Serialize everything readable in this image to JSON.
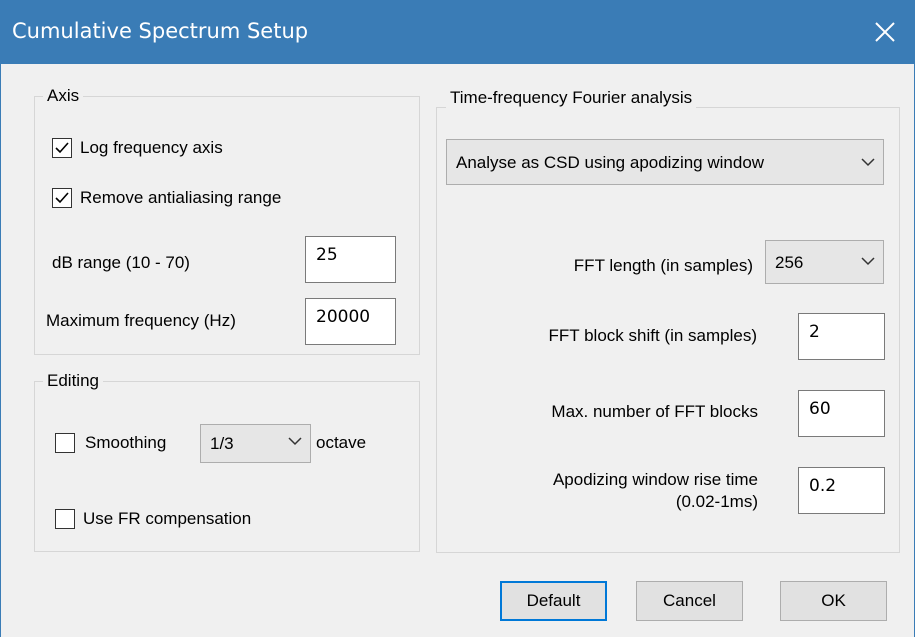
{
  "window": {
    "title": "Cumulative Spectrum Setup",
    "close_icon": "close-icon"
  },
  "axis": {
    "legend": "Axis",
    "log_frequency_label": "Log frequency axis",
    "log_frequency_checked": true,
    "remove_antialiasing_label": "Remove antialiasing range",
    "remove_antialiasing_checked": true,
    "db_range_label": "dB range (10 - 70)",
    "db_range_value": "25",
    "max_frequency_label": "Maximum frequency (Hz)",
    "max_frequency_value": "20000"
  },
  "editing": {
    "legend": "Editing",
    "smoothing_label": "Smoothing",
    "smoothing_checked": false,
    "smoothing_value": "1/3",
    "octave_label": "octave",
    "fr_compensation_label": "Use FR compensation",
    "fr_compensation_checked": false
  },
  "tf": {
    "legend": "Time-frequency Fourier analysis",
    "method_value": "Analyse as CSD using apodizing window",
    "fft_length_label": "FFT length (in samples)",
    "fft_length_value": "256",
    "block_shift_label": "FFT block shift (in samples)",
    "block_shift_value": "2",
    "max_blocks_label": "Max. number of FFT blocks",
    "max_blocks_value": "60",
    "rise_time_label_line1": "Apodizing window rise time",
    "rise_time_label_line2": "(0.02-1ms)",
    "rise_time_value": "0.2"
  },
  "buttons": {
    "default_label": "Default",
    "cancel_label": "Cancel",
    "ok_label": "OK"
  },
  "colors": {
    "titlebar": "#3a7cb6",
    "focus_border": "#0078d7"
  }
}
